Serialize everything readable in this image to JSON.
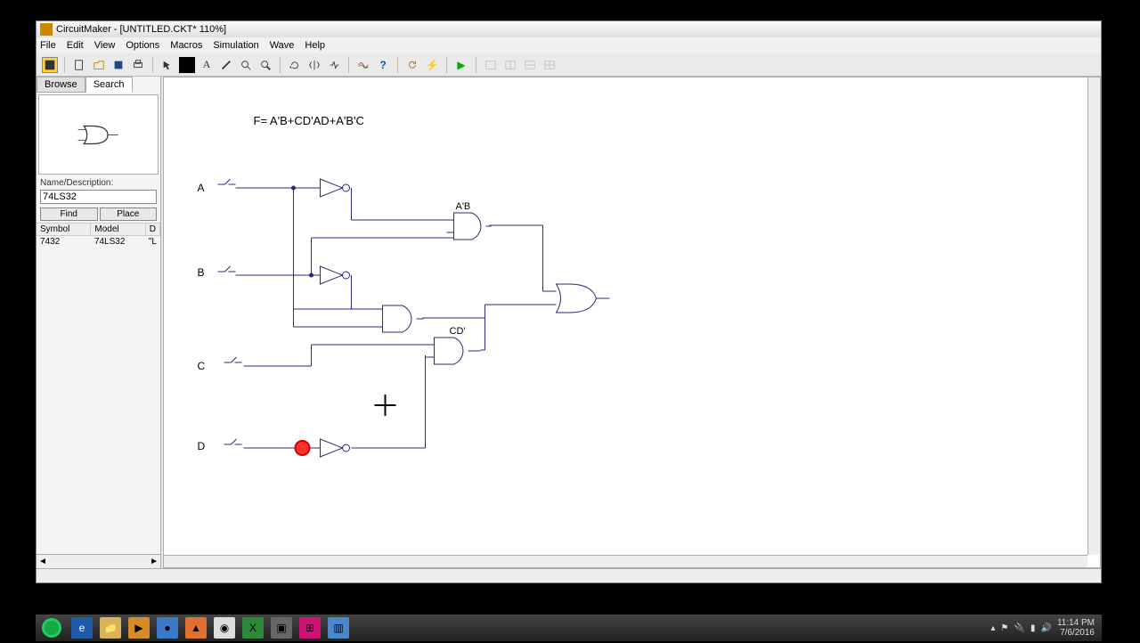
{
  "window": {
    "title": "CircuitMaker - [UNTITLED.CKT* 110%]"
  },
  "menu": {
    "file": "File",
    "edit": "Edit",
    "view": "View",
    "options": "Options",
    "macros": "Macros",
    "simulation": "Simulation",
    "wave": "Wave",
    "help": "Help"
  },
  "side": {
    "tab_browse": "Browse",
    "tab_search": "Search",
    "name_label": "Name/Description:",
    "name_value": "74LS32",
    "find": "Find",
    "place": "Place",
    "col_symbol": "Symbol",
    "col_model": "Model",
    "col_d": "D",
    "row_symbol": "7432",
    "row_model": "74LS32",
    "row_d": "\"L"
  },
  "circuit": {
    "equation": "F= A'B+CD'AD+A'B'C",
    "input_a": "A",
    "input_b": "B",
    "input_c": "C",
    "input_d": "D",
    "label_ab": "A'B",
    "label_cd": "CD'"
  },
  "tray": {
    "time": "11:14 PM",
    "date": "7/6/2016"
  },
  "scroll": {
    "left": "◄",
    "right": "►"
  }
}
